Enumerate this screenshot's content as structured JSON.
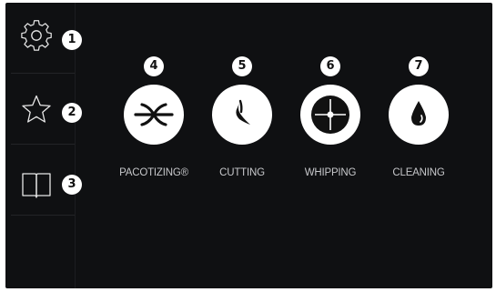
{
  "sidebar": {
    "items": [
      {
        "icon": "gear-icon",
        "badge": "1"
      },
      {
        "icon": "star-icon",
        "badge": "2"
      },
      {
        "icon": "book-icon",
        "badge": "3"
      }
    ]
  },
  "modes": [
    {
      "badge": "4",
      "label": "PACOTIZING®",
      "icon": "pacotizing-blade-icon"
    },
    {
      "badge": "5",
      "label": "CUTTING",
      "icon": "cutting-blade-icon"
    },
    {
      "badge": "6",
      "label": "WHIPPING",
      "icon": "whipping-disc-icon"
    },
    {
      "badge": "7",
      "label": "CLEANING",
      "icon": "water-drop-icon"
    }
  ],
  "colors": {
    "background": "#0f1012",
    "icon_circle": "#ffffff",
    "label_text": "#c6c7ca"
  }
}
